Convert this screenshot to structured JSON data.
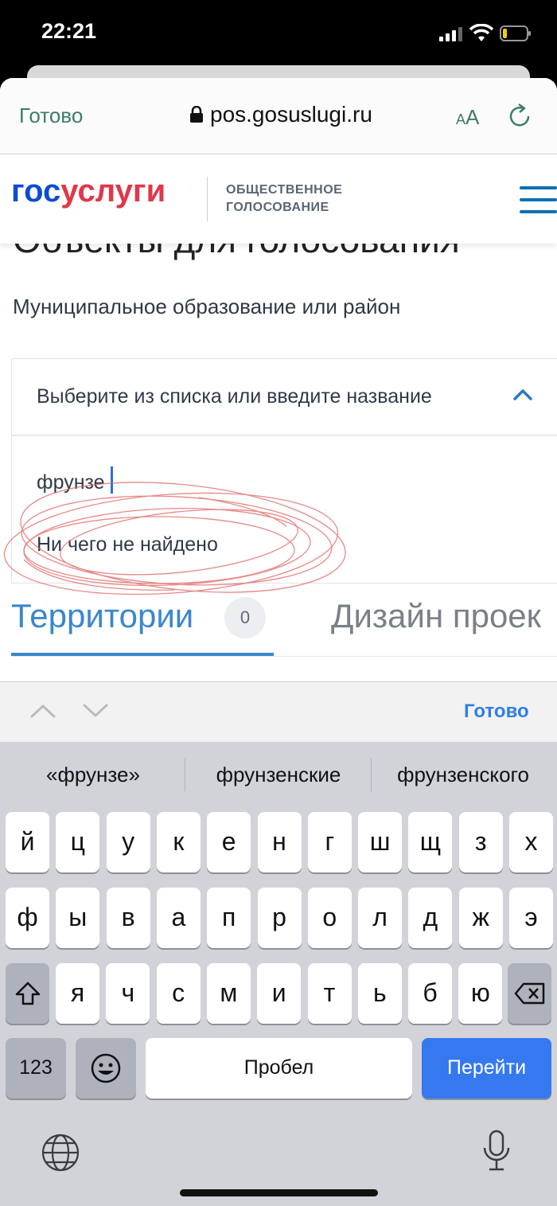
{
  "status": {
    "time": "22:21"
  },
  "browser": {
    "done": "Готово",
    "url": "pos.gosuslugi.ru",
    "text_size_small": "A",
    "text_size_large": "A"
  },
  "site": {
    "logo_part1": "гос",
    "logo_part2": "услуги",
    "subtitle_line1": "ОБЩЕСТВЕННОЕ",
    "subtitle_line2": "ГОЛОСОВАНИЕ"
  },
  "page": {
    "heading_cut": "Объекты для голосования",
    "field_label": "Муниципальное образование или район",
    "select_placeholder": "Выберите из списка или введите название",
    "search_value": "фрунзе",
    "no_results": "Ни чего не найдено",
    "tabs": [
      {
        "label": "Территории",
        "count": "0"
      },
      {
        "label": "Дизайн проек"
      }
    ]
  },
  "accessory": {
    "done": "Готово"
  },
  "keyboard": {
    "suggestions": [
      "«фрунзе»",
      "фрунзенские",
      "фрунзенского"
    ],
    "row1": [
      "й",
      "ц",
      "у",
      "к",
      "е",
      "н",
      "г",
      "ш",
      "щ",
      "з",
      "х"
    ],
    "row2": [
      "ф",
      "ы",
      "в",
      "а",
      "п",
      "р",
      "о",
      "л",
      "д",
      "ж",
      "э"
    ],
    "row3": [
      "я",
      "ч",
      "с",
      "м",
      "и",
      "т",
      "ь",
      "б",
      "ю"
    ],
    "numbers": "123",
    "space": "Пробел",
    "go": "Перейти"
  },
  "colors": {
    "accent_blue": "#0d4cd3",
    "accent_red": "#e0374a",
    "link_green": "#3f7b6e",
    "keyboard_blue": "#3578f0"
  }
}
